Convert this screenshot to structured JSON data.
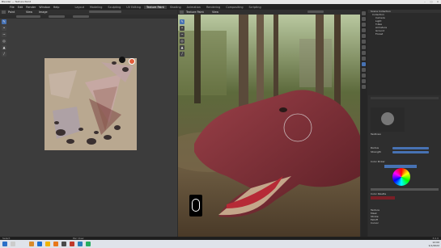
{
  "window": {
    "title": "Blender — Texture Paint"
  },
  "menu": [
    "File",
    "Edit",
    "Render",
    "Window",
    "Help"
  ],
  "workspace_tabs": [
    {
      "label": "Layout",
      "active": false
    },
    {
      "label": "Modeling",
      "active": false
    },
    {
      "label": "Sculpting",
      "active": false
    },
    {
      "label": "UV Editing",
      "active": false
    },
    {
      "label": "Texture Paint",
      "active": true
    },
    {
      "label": "Shading",
      "active": false
    },
    {
      "label": "Animation",
      "active": false
    },
    {
      "label": "Rendering",
      "active": false
    },
    {
      "label": "Compositing",
      "active": false
    },
    {
      "label": "Scripting",
      "active": false
    }
  ],
  "uv_editor": {
    "mode": "Paint",
    "view_label": "View",
    "image_label": "Image"
  },
  "viewport": {
    "mode": "Texture Paint",
    "view_label": "View"
  },
  "outliner": {
    "title": "Scene Collection",
    "items": [
      "Collection",
      "Camera",
      "Light",
      "T-Rex",
      "Armature",
      "Ground",
      "Forest"
    ]
  },
  "properties": {
    "brush_label": "TexDraw",
    "radius_label": "Radius",
    "radius_value": "50 px",
    "strength_label": "Strength",
    "strength_value": "1.000",
    "color_picker_label": "Color Picker",
    "palette_label": "Color Palette",
    "options": [
      "Texture",
      "Mask",
      "Stroke",
      "Falloff",
      "Cursor"
    ]
  },
  "statusbar": {
    "left": "Select",
    "center": "Pan View",
    "right": "3.0.0"
  },
  "taskbar": {
    "time": "12:00",
    "date": "1/1/2022"
  },
  "colors": {
    "accent": "#4772b3",
    "brush_color": "#7a1f26"
  }
}
